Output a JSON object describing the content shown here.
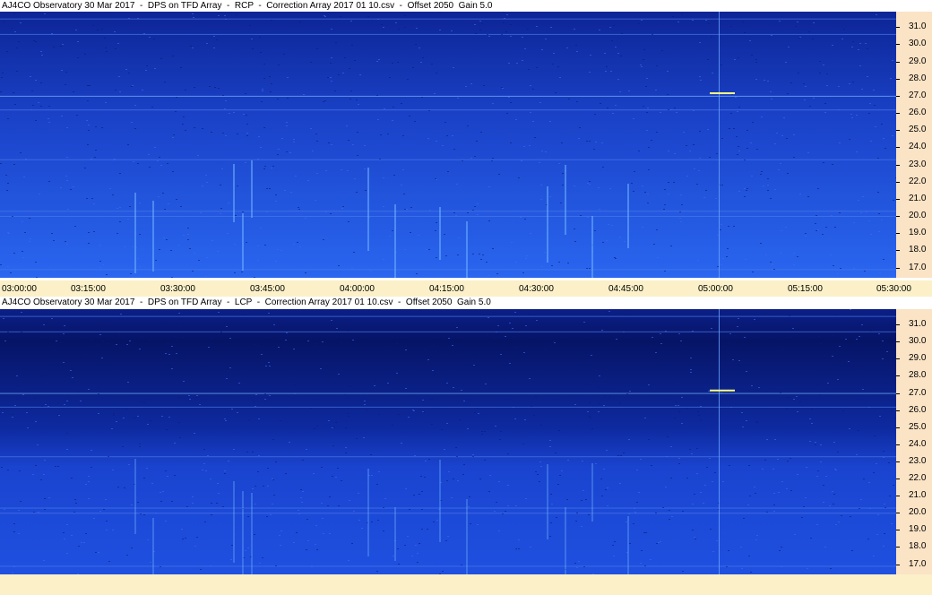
{
  "chart_data": [
    {
      "type": "heatmap",
      "title": "AJ4CO Observatory 30 Mar 2017  -  DPS on TFD Array  -  RCP  -  Correction Array 2017 01 10.csv  -  Offset 2050  Gain 5.0",
      "polarization": "RCP",
      "y_ticks": [
        "31.0",
        "30.0",
        "29.0",
        "28.0",
        "27.0",
        "26.0",
        "25.0",
        "24.0",
        "23.0",
        "22.0",
        "21.0",
        "20.0",
        "19.0",
        "18.0",
        "17.0"
      ],
      "ylim": [
        16.4,
        31.9
      ],
      "x_ticks": [
        "03:00:00",
        "03:15:00",
        "03:30:00",
        "03:45:00",
        "04:00:00",
        "04:15:00",
        "04:30:00",
        "04:45:00",
        "05:00:00",
        "05:15:00",
        "05:30:00"
      ],
      "colors": {
        "low": "#0a1d8a",
        "mid": "#1f4fe0",
        "high": "#8fd8ff",
        "peak": "#ffff80"
      }
    },
    {
      "type": "heatmap",
      "title": "AJ4CO Observatory 30 Mar 2017  -  DPS on TFD Array  -  LCP  -  Correction Array 2017 01 10.csv  -  Offset 2050  Gain 5.0",
      "polarization": "LCP",
      "y_ticks": [
        "31.0",
        "30.0",
        "29.0",
        "28.0",
        "27.0",
        "26.0",
        "25.0",
        "24.0",
        "23.0",
        "22.0",
        "21.0",
        "20.0",
        "19.0",
        "18.0",
        "17.0"
      ],
      "ylim": [
        16.4,
        31.9
      ],
      "x_ticks": [],
      "colors": {
        "low": "#061466",
        "mid": "#1a44d0",
        "high": "#7fc8ff",
        "peak": "#ffff80"
      }
    }
  ]
}
